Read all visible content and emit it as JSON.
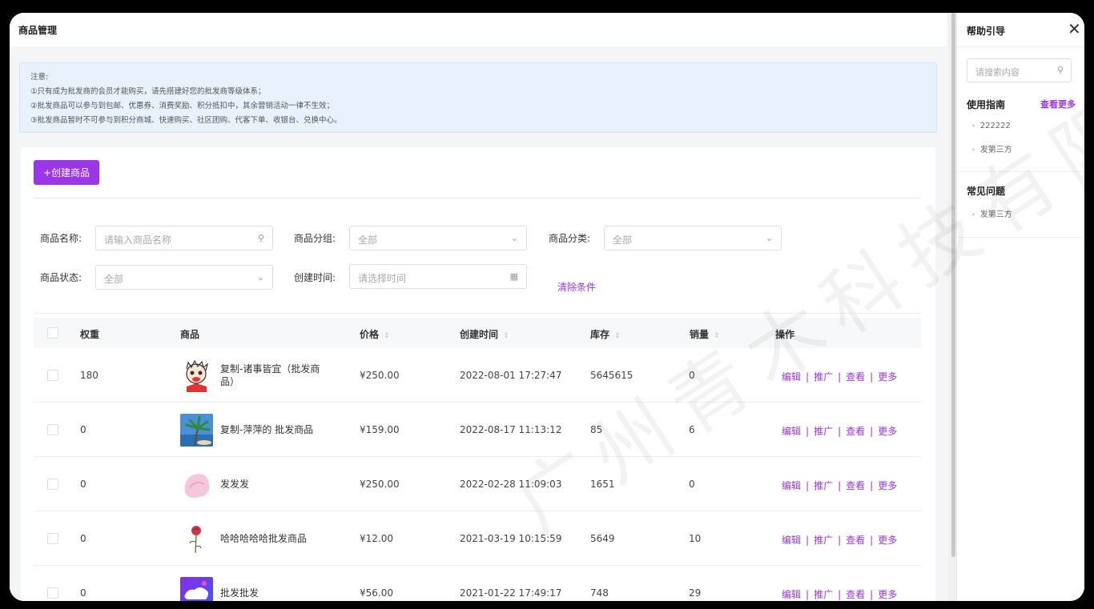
{
  "page_title": "商品管理",
  "notice": {
    "lines": [
      "注意:",
      "①只有成为批发商的会员才能购买，请先搭建好您的批发商等级体系；",
      "②批发商品可以参与到包邮、优惠券、消费奖励、积分抵扣中，其余营销活动一律不生效；",
      "③批发商品暂时不可参与到积分商城、快速购买、社区团购、代客下单、收银台、兑换中心。"
    ]
  },
  "create_button": "+创建商品",
  "filters": {
    "name_label": "商品名称:",
    "name_placeholder": "请输入商品名称",
    "group_label": "商品分组:",
    "group_value": "全部",
    "category_label": "商品分类:",
    "category_value": "全部",
    "status_label": "商品状态:",
    "status_value": "全部",
    "time_label": "创建时间:",
    "time_placeholder": "请选择时间",
    "clear": "清除条件"
  },
  "table": {
    "headers": [
      "权重",
      "商品",
      "价格",
      "创建时间",
      "库存",
      "销量",
      "操作"
    ],
    "rows": [
      {
        "weight": "180",
        "name": "复制-诸事皆宜（批发商品）",
        "price": "¥250.00",
        "created": "2022-08-01 17:27:47",
        "stock": "5645615",
        "sales": "0",
        "thumb": "cartoon-face"
      },
      {
        "weight": "0",
        "name": "复制-萍萍的 批发商品",
        "price": "¥159.00",
        "created": "2022-08-17 11:13:12",
        "stock": "85",
        "sales": "6",
        "thumb": "palm-tree"
      },
      {
        "weight": "0",
        "name": "发发发",
        "price": "¥250.00",
        "created": "2022-02-28 11:09:03",
        "stock": "1651",
        "sales": "0",
        "thumb": "pink-flower"
      },
      {
        "weight": "0",
        "name": "哈哈哈哈哈批发商品",
        "price": "¥12.00",
        "created": "2021-03-19 10:15:59",
        "stock": "5649",
        "sales": "10",
        "thumb": "rose"
      },
      {
        "weight": "0",
        "name": "批发批发",
        "price": "¥56.00",
        "created": "2021-01-22 17:49:17",
        "stock": "748",
        "sales": "29",
        "thumb": "purple-shape"
      }
    ],
    "ops": [
      "编辑",
      "推广",
      "查看",
      "更多"
    ]
  },
  "help": {
    "title": "帮助引导",
    "search_placeholder": "请搜索内容",
    "guide_title": "使用指南",
    "guide_more": "查看更多",
    "guide_items": [
      "222222",
      "发第三方"
    ],
    "faq_title": "常见问题",
    "faq_items": [
      "发第三方"
    ]
  },
  "watermark": "广州青木科技有限公",
  "colors": {
    "accent": "#9b35e8",
    "notice_bg": "#e8f1fc"
  }
}
